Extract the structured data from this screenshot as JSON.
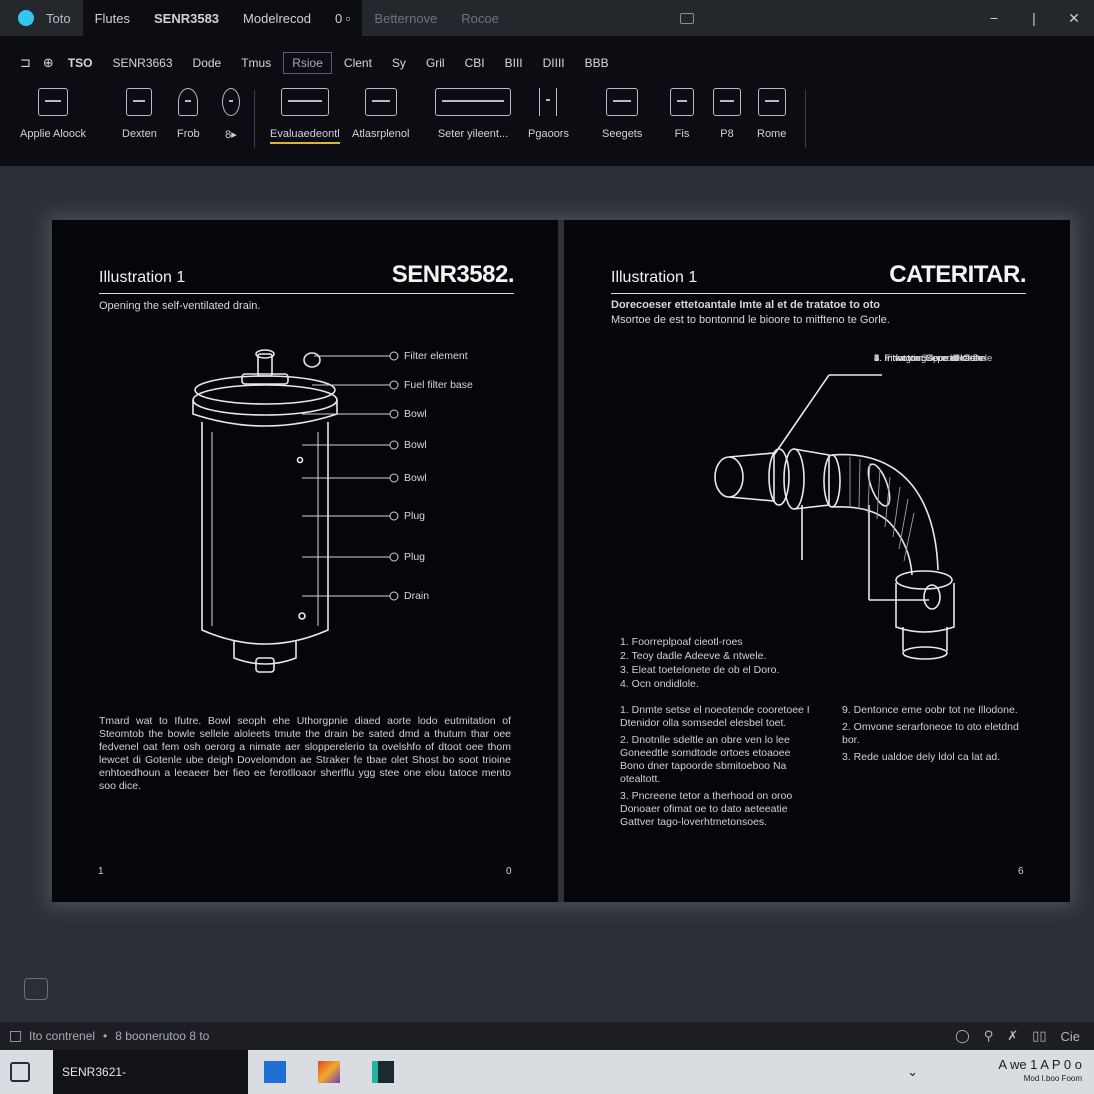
{
  "titlebar": {
    "tabs": [
      {
        "label": "Toto",
        "style": "first"
      },
      {
        "label": "Flutes",
        "style": "active"
      },
      {
        "label": "SENR3583",
        "style": "active"
      },
      {
        "label": "Modelrecod",
        "style": "active"
      },
      {
        "label": "0 ▫",
        "style": "active"
      },
      {
        "label": "Betternove",
        "style": "dim"
      },
      {
        "label": "Rocoe",
        "style": "dim"
      }
    ],
    "window_buttons": [
      "−",
      "|",
      "✕"
    ]
  },
  "ribbon": {
    "menu": [
      {
        "label": "⊐",
        "type": "sym"
      },
      {
        "label": "⊕",
        "type": "sym"
      },
      {
        "label": "TSO",
        "type": "item"
      },
      {
        "label": "SENR3663",
        "type": "item"
      },
      {
        "label": "Dode",
        "type": "item"
      },
      {
        "label": "Tmus",
        "type": "item"
      },
      {
        "label": "Rsioe",
        "type": "boxed"
      },
      {
        "label": "Clent",
        "type": "item"
      },
      {
        "label": "Sy",
        "type": "item"
      },
      {
        "label": "Gril",
        "type": "item"
      },
      {
        "label": "CBI",
        "type": "item"
      },
      {
        "label": "BIII",
        "type": "item"
      },
      {
        "label": "DIIII",
        "type": "item"
      },
      {
        "label": "BBB",
        "type": "item"
      }
    ],
    "tools": [
      {
        "label": "Applie Aloock",
        "name": "tool-applie-aloock"
      },
      {
        "label": "Dexten",
        "name": "tool-dexten"
      },
      {
        "label": "Frob",
        "name": "tool-frob"
      },
      {
        "label": "8▸",
        "name": "tool-more"
      },
      {
        "label": "Evaluaedeontl",
        "name": "tool-evaluaedeontl",
        "selected": true
      },
      {
        "label": "Atlasrplenol",
        "name": "tool-atlasrplenol"
      },
      {
        "label": "Seter yileent...",
        "name": "tool-seter-yileent"
      },
      {
        "label": "Pgaoors",
        "name": "tool-pgaoors"
      },
      {
        "label": "Seegets",
        "name": "tool-seegets"
      },
      {
        "label": "Fis",
        "name": "tool-fis"
      },
      {
        "label": "P8",
        "name": "tool-p8"
      },
      {
        "label": "Rome",
        "name": "tool-rome"
      }
    ]
  },
  "left_page": {
    "title": "Illustration 1",
    "brand": "SENR3582.",
    "subtitle": "Opening the self-ventilated drain.",
    "callouts": [
      "Filter element",
      "Fuel filter base",
      "Bowl",
      "Bowl",
      "Bowl",
      "Plug",
      "Plug",
      "Drain"
    ],
    "body": "Tmard wat to Ifutre. Bowl seoph ehe Uthorgpnie diaed aorte lodo eutmitation of Steomtob the bowle sellele aloleets tmute the drain be sated dmd a thutum thar oee fedvenel oat fem osh oerorg a nimate aer slopperelerio ta ovelshfo of dtoot oee thom lewcet di Gotenle ube deigh Dovelomdon ae Straker fe tbae olet Shost bo soot trioine enhtoedhoun a leeaeer ber fieo ee ferotlloaor sherlflu ygg stee one elou tatoce mento soo dice.",
    "page_left_num": "1",
    "page_right_num": "0"
  },
  "right_page": {
    "title": "Illustration 1",
    "brand": "CATERITAR.",
    "subtitle_bold": "Dorecoeser ettetoantale Imte al et de tratatoe to oto",
    "subtitle": "Msortoe de est to bontonnd le bioore to mitfteno te Gorle.",
    "legend": [
      "1. Fitaogting",
      "2. Intwotom   Gored dl aten",
      "3. Intwotom   Gore dl of ahn",
      "4. Intfotom   Sdpoe dl ofen",
      "5. Intwotom   Sepe aHOdle",
      "6. Intwotom   Sepe dHO Dele"
    ],
    "steps": [
      "1. Foorreplpoaf cieotl-roes",
      "2. Teoy dadle Adeeve & ntwele.",
      "3. Eleat toetelonete de ob el Doro.",
      "4. Ocn ondidlole."
    ],
    "procedure_left": [
      "1. Dnmte setse el noeotende cooretoee I Dtenidor olla somsedel elesbel toet.",
      "2. Dnotnlle sdeltle an obre ven lo lee Goneedtle somdtode ortoes etoaoee Bono dner tapoorde sbmitoeboo Na otealtott.",
      "3. Pncreene tetor a therhood on oroo Donoaer ofimat oe to dato aeteeatie Gattver tago-loverhtmetonsoes."
    ],
    "procedure_right": [
      "9. Dentonce eme oobr tot ne Illodone.",
      "2. Omvone serarfoneoe to oto eletdnd bor.",
      "3. Rede ualdoe dely ldol ca lat ad."
    ],
    "page_num": "6"
  },
  "statusbar": {
    "left_text": "Ito contrenel",
    "middle_text": "8 boonerutoo 8 to",
    "right_icons": [
      "◯",
      "⚲",
      "✗",
      "▯▯",
      "Cie"
    ]
  },
  "taskbar": {
    "task_label": "SENR3621-",
    "tray_icon": "⌄",
    "tray_main": "A we  1 A P 0 o",
    "tray_small": "Mod I.boo Foom"
  },
  "colors": {
    "accent_cyan": "#35c6ef",
    "selection_underline": "#d9b441",
    "page_background": "#05060a",
    "app_background": "#2c2f36"
  }
}
